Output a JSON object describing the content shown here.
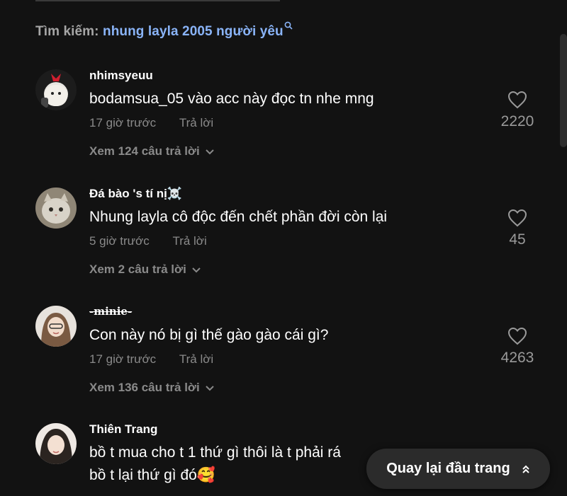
{
  "search": {
    "label": "Tìm kiếm:",
    "query": "nhung layla 2005 người yêu",
    "icon": "search-icon"
  },
  "comments": [
    {
      "username": "nhimsyeuu",
      "text": "bodamsua_05 vào acc này đọc tn nhe mng",
      "time": "17 giờ trước",
      "reply": "Trả lời",
      "view_replies": "Xem 124 câu trả lời",
      "likes": "2220"
    },
    {
      "username": "Đá bào 's tí nị☠️",
      "text": "Nhung layla cô độc đến chết phần đời còn lại",
      "time": "5 giờ trước",
      "reply": "Trả lời",
      "view_replies": "Xem 2 câu trả lời",
      "likes": "45"
    },
    {
      "username": "-minie-",
      "text": "Con này nó bị gì thế gào gào cái gì?",
      "time": "17 giờ trước",
      "reply": "Trả lời",
      "view_replies": "Xem 136 câu trả lời",
      "likes": "4263"
    },
    {
      "username": "Thiên Trang",
      "line1": "bồ t mua cho t 1 thứ gì thôi là t phải rá",
      "line2": "bồ t lại thứ gì đó🥰"
    }
  ],
  "back_to_top": "Quay lại đầu trang",
  "colors": {
    "background": "#121212",
    "query": "#8ab4f8",
    "muted": "#8a8a8a",
    "button_bg": "#2b2b2b"
  }
}
